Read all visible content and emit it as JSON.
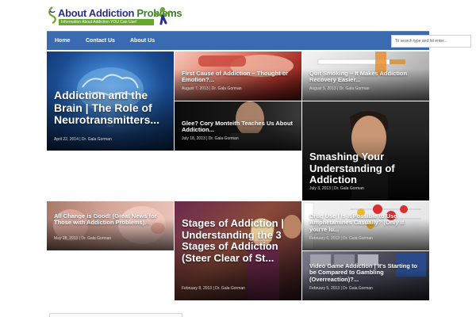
{
  "logo": {
    "part1": "About ",
    "part2": "Addiction",
    "part3": " Problems",
    "tagline": "Information About Addiction YOU Can Use!"
  },
  "nav": {
    "items": [
      "Home",
      "Contact Us",
      "About Us"
    ],
    "search_placeholder": "To search type and hit enter..."
  },
  "posts": [
    {
      "title": "Addiction and the Brain | The Role of Neurotransmitters...",
      "meta": "April 22, 2014 | Dr. Gala Gorman"
    },
    {
      "title": "First Cause of Addiction – Thought or Emotion?...",
      "meta": "August 7, 2013 | Dr. Gala Gorman"
    },
    {
      "title": "Quit Smoking – It Makes Addiction Recovery Easier...",
      "meta": "August 5, 2013 | Dr. Gala Gorman"
    },
    {
      "title": "Glee? Cory Monteith Teaches Us About Addiction...",
      "meta": "July 18, 2013 | Dr. Gala Gorman"
    },
    {
      "title": "Smashing Your Understanding of Addiction",
      "meta": "July 3, 2013 | Dr. Gala Gorman"
    },
    {
      "title": "All Change is Good! (Great News for Those with Addiction Problems)...",
      "meta": "May 28, 2013 | Dr. Gala Gorman"
    },
    {
      "title": "Stages of Addiction | Understanding the 3 Stages of Addiction (Steer Clear of St...",
      "meta": "February 8, 2013 | Dr. Gala Gorman"
    },
    {
      "title": "Drug Use | Is It Possible to Use Amphetamines Casually? (Only if you're lu...",
      "meta": "February 6, 2013 | Dr. Gala Gorman"
    },
    {
      "title": "Video Game Addiction | It's Starting to be Compared to Gambling (Overreaction)?...",
      "meta": "February 5, 2013 | Dr. Gala Gorman"
    }
  ],
  "colors": {
    "nav": "#3a6bb0",
    "logo_blue": "#2a2f8a",
    "logo_green": "#6aa532"
  }
}
